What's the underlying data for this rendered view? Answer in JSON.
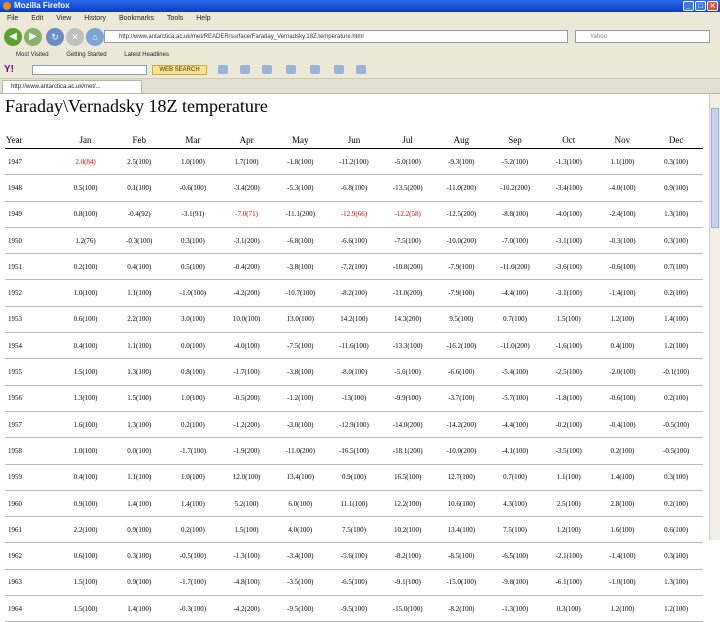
{
  "window": {
    "title": "Mozilla Firefox"
  },
  "menu": [
    "File",
    "Edit",
    "View",
    "History",
    "Bookmarks",
    "Tools",
    "Help"
  ],
  "nav": {
    "url": "http://www.antarctica.ac.uk/met/READER/surface/Faraday_Vernadsky.18Z.temperature.html",
    "search_placeholder": "Yahoo"
  },
  "bookmarks": [
    "Most Visited",
    "Getting Started",
    "Latest Headlines"
  ],
  "yahoo": {
    "logo": "Y!",
    "search_button": "WEB SEARCH"
  },
  "tab": {
    "label": "http://www.antarctica.ac.uk/met/..."
  },
  "page": {
    "title": "Faraday\\Vernadsky 18Z temperature",
    "headers": [
      "Year",
      "Jan",
      "Feb",
      "Mar",
      "Apr",
      "May",
      "Jun",
      "Jul",
      "Aug",
      "Sep",
      "Oct",
      "Nov",
      "Dec"
    ],
    "rows": [
      [
        "1947",
        "2.0(84)",
        "2.5(100)",
        "1.0(100)",
        "1.7(100)",
        "-1.8(100)",
        "-11.2(100)",
        "-5.0(100)",
        "-9.3(100)",
        "-5.2(100)",
        "-1.3(100)",
        "1.1(100)",
        "0.3(100)"
      ],
      [
        "1948",
        "0.5(100)",
        "0.1(100)",
        "-0.6(100)",
        "-3.4(200)",
        "-5.3(100)",
        "-6.8(100)",
        "-13.5(200)",
        "-11.0(200)",
        "-10.2(200)",
        "-3.4(100)",
        "-4.0(100)",
        "0.9(100)"
      ],
      [
        "1949",
        "0.8(100)",
        "-0.4(92)",
        "-3.1(91)",
        "-7.0(71)",
        "-11.1(200)",
        "-12.9(66)",
        "-12.2(58)",
        "-12.5(200)",
        "-8.8(100)",
        "-4.0(100)",
        "-2.4(100)",
        "1.3(100)"
      ],
      [
        "1950",
        "1.2(76)",
        "-0.3(100)",
        "0.3(100)",
        "-3.1(200)",
        "-6.8(100)",
        "-6.6(100)",
        "-7.5(100)",
        "-10.0(200)",
        "-7.0(100)",
        "-3.1(100)",
        "-0.3(100)",
        "0.3(100)"
      ],
      [
        "1951",
        "0.2(100)",
        "0.4(100)",
        "0.5(100)",
        "-0.4(200)",
        "-3.8(100)",
        "-7.2(100)",
        "-10.8(200)",
        "-7.9(100)",
        "-11.0(200)",
        "-3.6(100)",
        "-0.6(100)",
        "0.7(100)"
      ],
      [
        "1952",
        "1.0(100)",
        "1.1(100)",
        "-1.0(100)",
        "-4.2(200)",
        "-10.7(100)",
        "-8.2(100)",
        "-11.0(200)",
        "-7.9(100)",
        "-4.4(100)",
        "-3.1(100)",
        "-1.4(100)",
        "0.2(100)"
      ],
      [
        "1953",
        "0.6(100)",
        "2.2(100)",
        "3.0(100)",
        "10.0(100)",
        "13.0(100)",
        "14.2(100)",
        "14.3(200)",
        "9.5(100)",
        "0.7(100)",
        "1.5(100)",
        "1.2(100)",
        "1.4(100)"
      ],
      [
        "1954",
        "0.4(100)",
        "1.1(100)",
        "0.0(100)",
        "-4.0(100)",
        "-7.5(100)",
        "-11.6(100)",
        "-13.3(100)",
        "-16.2(100)",
        "-11.0(200)",
        "-1.6(100)",
        "0.4(100)",
        "1.2(100)"
      ],
      [
        "1955",
        "1.5(100)",
        "1.3(100)",
        "0.8(100)",
        "-1.7(100)",
        "-3.8(100)",
        "-8.0(100)",
        "-5.6(100)",
        "-6.6(100)",
        "-5.4(100)",
        "-2.5(100)",
        "-2.0(100)",
        "-0.1(100)"
      ],
      [
        "1956",
        "1.3(100)",
        "1.5(100)",
        "1.0(100)",
        "-0.5(200)",
        "-1.2(100)",
        "-13(100)",
        "-9.9(100)",
        "-3.7(100)",
        "-5.7(100)",
        "-1.8(100)",
        "-0.6(100)",
        "0.2(100)"
      ],
      [
        "1957",
        "1.6(100)",
        "1.3(100)",
        "0.2(100)",
        "-1.2(200)",
        "-3.0(100)",
        "-12.9(100)",
        "-14.0(200)",
        "-14.2(200)",
        "-4.4(100)",
        "-0.2(100)",
        "-0.4(100)",
        "-0.5(100)"
      ],
      [
        "1958",
        "1.0(100)",
        "0.0(100)",
        "-1.7(100)",
        "-1.9(200)",
        "-11.0(200)",
        "-16.5(100)",
        "-18.1(200)",
        "-10.0(200)",
        "-4.1(100)",
        "-3.5(100)",
        "0.2(100)",
        "-0.5(100)"
      ],
      [
        "1959",
        "0.4(100)",
        "1.1(100)",
        "1.0(100)",
        "12.0(100)",
        "13.4(100)",
        "0.9(100)",
        "16.5(100)",
        "12.7(100)",
        "0.7(100)",
        "1.1(100)",
        "1.4(100)",
        "0.3(100)"
      ],
      [
        "1960",
        "0.9(100)",
        "1.4(100)",
        "1.4(100)",
        "5.2(100)",
        "6.0(100)",
        "11.1(100)",
        "12.2(100)",
        "10.6(100)",
        "4.3(100)",
        "2.5(100)",
        "2.8(100)",
        "0.2(100)"
      ],
      [
        "1961",
        "2.2(100)",
        "0.9(100)",
        "0.2(100)",
        "1.5(100)",
        "4.0(100)",
        "7.5(100)",
        "10.2(100)",
        "13.4(100)",
        "7.5(100)",
        "1.2(100)",
        "1.6(100)",
        "0.6(100)"
      ],
      [
        "1962",
        "0.6(100)",
        "0.3(100)",
        "-0.5(100)",
        "-1.3(100)",
        "-3.4(100)",
        "-5.6(100)",
        "-8.2(100)",
        "-8.5(100)",
        "-6.5(100)",
        "-2.1(100)",
        "-1.4(100)",
        "0.3(100)"
      ],
      [
        "1963",
        "1.5(100)",
        "0.9(100)",
        "-1.7(100)",
        "-4.8(100)",
        "-3.5(100)",
        "-6.5(100)",
        "-9.1(100)",
        "-15.0(100)",
        "-9.8(100)",
        "-6.1(100)",
        "-1.0(100)",
        "1.3(100)"
      ],
      [
        "1964",
        "1.5(100)",
        "1.4(100)",
        "-0.3(100)",
        "-4.2(200)",
        "-9.5(100)",
        "-9.5(100)",
        "-15.0(100)",
        "-8.2(100)",
        "-1.3(100)",
        "0.3(100)",
        "1.2(100)",
        "1.2(100)"
      ]
    ],
    "red_cells": [
      [
        0,
        1
      ],
      [
        2,
        4
      ],
      [
        2,
        6
      ],
      [
        2,
        7
      ]
    ]
  },
  "colors": {
    "accent": "#0b3fc4",
    "highlight_red": "#cc0000"
  }
}
